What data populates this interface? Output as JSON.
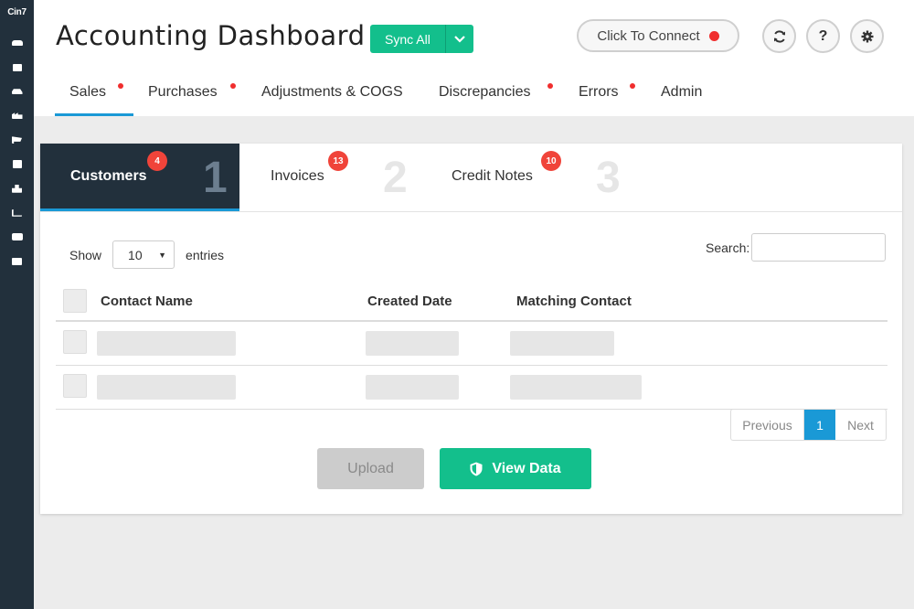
{
  "sidebar": {
    "logo": "Cin7",
    "items": [
      {
        "icon": "users-icon"
      },
      {
        "icon": "box-icon"
      },
      {
        "icon": "car-icon"
      },
      {
        "icon": "factory-icon"
      },
      {
        "icon": "cart-icon"
      },
      {
        "icon": "layers-icon"
      },
      {
        "icon": "boxes-icon"
      },
      {
        "icon": "chart-icon"
      },
      {
        "icon": "briefcase-icon"
      },
      {
        "icon": "storefront-icon"
      }
    ]
  },
  "header": {
    "title": "Accounting Dashboard",
    "sync_label": "Sync All",
    "connect_label": "Click To Connect",
    "connect_status_color": "#f02e2e",
    "icons": [
      "refresh-icon",
      "help-icon",
      "gear-icon"
    ],
    "help_glyph": "?"
  },
  "nav": {
    "tabs": [
      {
        "label": "Sales",
        "alert": true,
        "active": true
      },
      {
        "label": "Purchases",
        "alert": true
      },
      {
        "label": "Adjustments & COGS",
        "alert": false
      },
      {
        "label": "Discrepancies",
        "alert": true
      },
      {
        "label": "Errors",
        "alert": true
      },
      {
        "label": "Admin",
        "alert": false
      }
    ]
  },
  "steps": [
    {
      "label": "Customers",
      "badge": "4",
      "number": "1",
      "active": true
    },
    {
      "label": "Invoices",
      "badge": "13",
      "number": "2"
    },
    {
      "label": "Credit Notes",
      "badge": "10",
      "number": "3"
    }
  ],
  "table_controls": {
    "show_label": "Show",
    "entries_value": "10",
    "entries_label": "entries",
    "search_label": "Search:"
  },
  "table": {
    "columns": [
      "Contact Name",
      "Created Date",
      "Matching Contact"
    ],
    "row_count": 2
  },
  "pagination": {
    "previous": "Previous",
    "current": "1",
    "next": "Next"
  },
  "actions": {
    "upload": "Upload",
    "view": "View Data"
  },
  "colors": {
    "accent_green": "#13bf8c",
    "accent_blue": "#1a99d6",
    "sidebar_bg": "#22303c",
    "alert_red": "#f02e2e"
  }
}
